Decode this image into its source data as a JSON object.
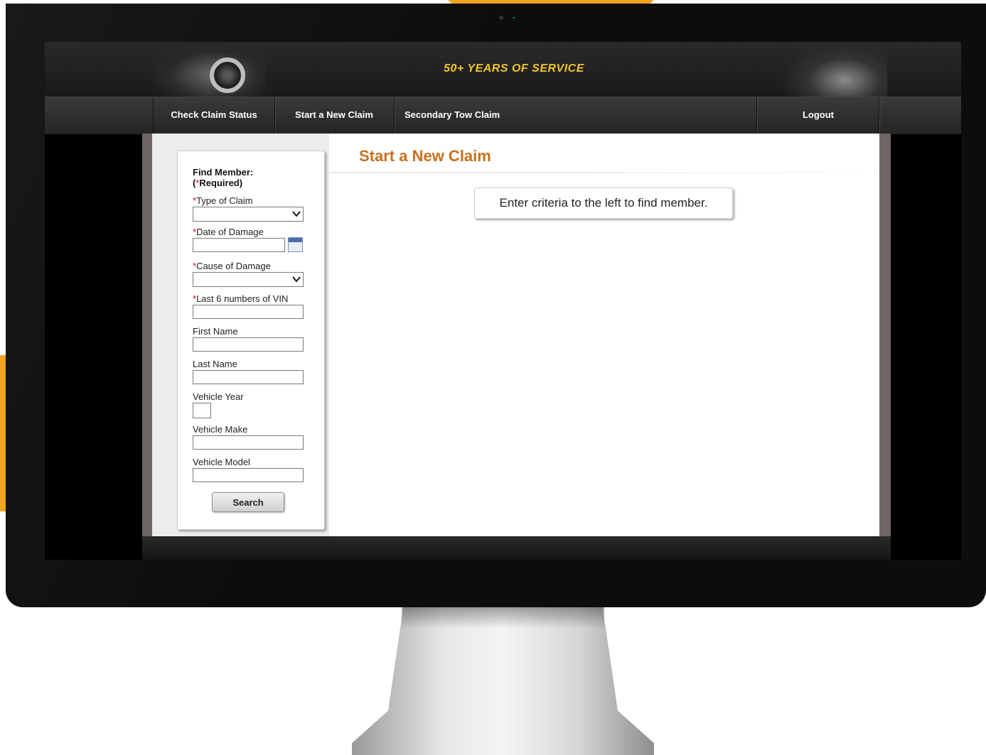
{
  "site": {
    "tagline": "50+ YEARS OF SERVICE"
  },
  "nav": {
    "items": [
      "Check Claim Status",
      "Start a New Claim",
      "Secondary Tow Claim"
    ],
    "logout": "Logout"
  },
  "find_member": {
    "heading": "Find Member:",
    "required_note": "Required)",
    "required_prefix": "(",
    "required_star": "*",
    "fields": {
      "type_of_claim": {
        "label": "Type of Claim",
        "required": true,
        "value": ""
      },
      "date_of_damage": {
        "label": "Date of Damage",
        "required": true,
        "value": ""
      },
      "cause_of_damage": {
        "label": "Cause of Damage",
        "required": true,
        "value": ""
      },
      "vin_last6": {
        "label": "Last 6 numbers of VIN",
        "required": true,
        "value": ""
      },
      "first_name": {
        "label": "First Name",
        "value": ""
      },
      "last_name": {
        "label": "Last Name",
        "value": ""
      },
      "vehicle_year": {
        "label": "Vehicle Year",
        "value": ""
      },
      "vehicle_make": {
        "label": "Vehicle Make",
        "value": ""
      },
      "vehicle_model": {
        "label": "Vehicle Model",
        "value": ""
      }
    },
    "search_button": "Search"
  },
  "main": {
    "title": "Start a New Claim",
    "notice": "Enter criteria to the left to find member."
  },
  "colors": {
    "title": "#c9701c",
    "tagline": "#f2c430",
    "required_star": "#d0021b",
    "accent_orange": "#f2a322"
  },
  "icons": [
    "calendar-icon",
    "chevron-down-icon"
  ]
}
